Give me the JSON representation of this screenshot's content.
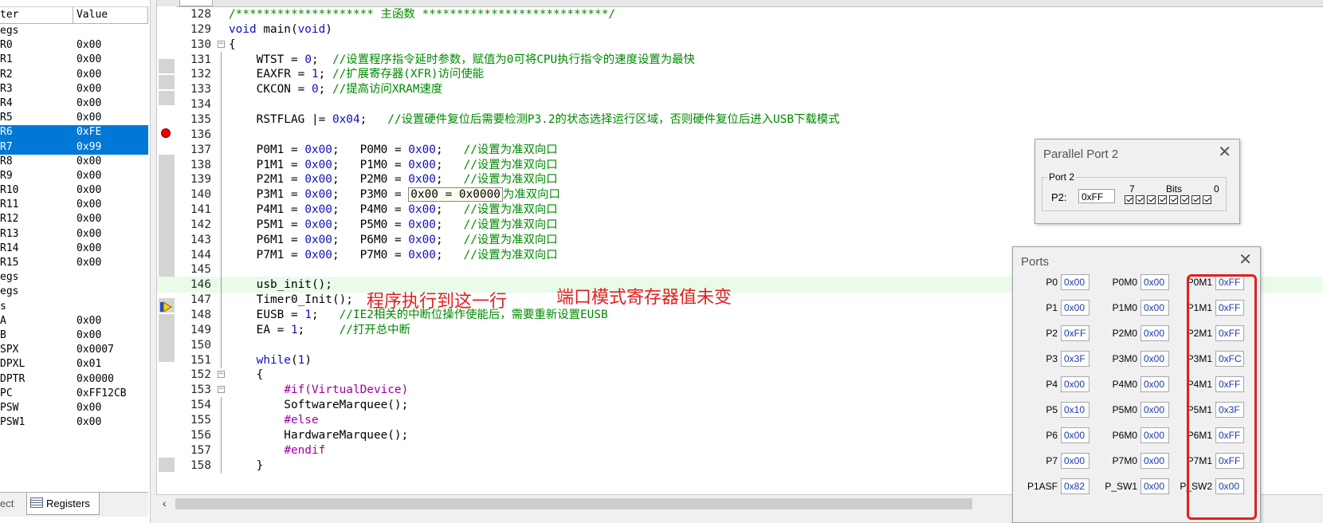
{
  "registers": {
    "header": {
      "name": "ter",
      "value": "Value"
    },
    "rows": [
      {
        "name": "egs",
        "value": "",
        "selected": false
      },
      {
        "name": "R0",
        "value": "0x00",
        "selected": false
      },
      {
        "name": "R1",
        "value": "0x00",
        "selected": false
      },
      {
        "name": "R2",
        "value": "0x00",
        "selected": false
      },
      {
        "name": "R3",
        "value": "0x00",
        "selected": false
      },
      {
        "name": "R4",
        "value": "0x00",
        "selected": false
      },
      {
        "name": "R5",
        "value": "0x00",
        "selected": false
      },
      {
        "name": "R6",
        "value": "0xFE",
        "selected": true
      },
      {
        "name": "R7",
        "value": "0x99",
        "selected": true
      },
      {
        "name": "R8",
        "value": "0x00",
        "selected": false
      },
      {
        "name": "R9",
        "value": "0x00",
        "selected": false
      },
      {
        "name": "R10",
        "value": "0x00",
        "selected": false
      },
      {
        "name": "R11",
        "value": "0x00",
        "selected": false
      },
      {
        "name": "R12",
        "value": "0x00",
        "selected": false
      },
      {
        "name": "R13",
        "value": "0x00",
        "selected": false
      },
      {
        "name": "R14",
        "value": "0x00",
        "selected": false
      },
      {
        "name": "R15",
        "value": "0x00",
        "selected": false
      },
      {
        "name": "egs",
        "value": "",
        "selected": false
      },
      {
        "name": "egs",
        "value": "",
        "selected": false
      },
      {
        "name": "s",
        "value": "",
        "selected": false
      },
      {
        "name": "A",
        "value": "0x00",
        "selected": false
      },
      {
        "name": "B",
        "value": "0x00",
        "selected": false
      },
      {
        "name": "SPX",
        "value": "0x0007",
        "selected": false
      },
      {
        "name": "DPXL",
        "value": "0x01",
        "selected": false
      },
      {
        "name": "DPTR",
        "value": "0x0000",
        "selected": false
      },
      {
        "name": "PC",
        "value": "0xFF12CB",
        "selected": false
      },
      {
        "name": "PSW",
        "value": "0x00",
        "selected": false
      },
      {
        "name": "PSW1",
        "value": "0x00",
        "selected": false
      }
    ],
    "tabs": {
      "project": "ect",
      "registers": "Registers"
    }
  },
  "editor": {
    "lines": [
      {
        "num": "128",
        "fold": "",
        "text": [
          [
            "cm",
            "/******************** 主函数 ***************************/"
          ]
        ]
      },
      {
        "num": "129",
        "fold": "",
        "text": [
          [
            "kw",
            "void"
          ],
          [
            "",
            " main("
          ],
          [
            "kw",
            "void"
          ],
          [
            "",
            ")"
          ]
        ]
      },
      {
        "num": "130",
        "fold": "box",
        "text": [
          [
            "",
            "{"
          ]
        ]
      },
      {
        "num": "131",
        "fold": "line",
        "text": [
          [
            "",
            "    WTST = "
          ],
          [
            "num",
            "0"
          ],
          [
            "",
            ";  "
          ],
          [
            "cm",
            "//设置程序指令延时参数，赋值为0可将CPU执行指令的速度设置为最快"
          ]
        ]
      },
      {
        "num": "132",
        "fold": "line",
        "text": [
          [
            "",
            "    EAXFR = "
          ],
          [
            "num",
            "1"
          ],
          [
            "",
            "; "
          ],
          [
            "cm",
            "//扩展寄存器(XFR)访问使能"
          ]
        ]
      },
      {
        "num": "133",
        "fold": "line",
        "text": [
          [
            "",
            "    CKCON = "
          ],
          [
            "num",
            "0"
          ],
          [
            "",
            "; "
          ],
          [
            "cm",
            "//提高访问XRAM速度"
          ]
        ]
      },
      {
        "num": "134",
        "fold": "line",
        "text": [
          [
            "",
            ""
          ]
        ]
      },
      {
        "num": "135",
        "fold": "line",
        "text": [
          [
            "",
            "    RSTFLAG |= "
          ],
          [
            "num",
            "0x04"
          ],
          [
            "",
            ";   "
          ],
          [
            "cm",
            "//设置硬件复位后需要检测P3.2的状态选择运行区域，否则硬件复位后进入USB下载模式"
          ]
        ]
      },
      {
        "num": "136",
        "fold": "line",
        "text": [
          [
            "",
            ""
          ]
        ]
      },
      {
        "num": "137",
        "fold": "line",
        "text": [
          [
            "",
            "    P0M1 = "
          ],
          [
            "num",
            "0x00"
          ],
          [
            "",
            ";   P0M0 = "
          ],
          [
            "num",
            "0x00"
          ],
          [
            "",
            ";   "
          ],
          [
            "cm",
            "//设置为准双向口"
          ]
        ]
      },
      {
        "num": "138",
        "fold": "line",
        "text": [
          [
            "",
            "    P1M1 = "
          ],
          [
            "num",
            "0x00"
          ],
          [
            "",
            ";   P1M0 = "
          ],
          [
            "num",
            "0x00"
          ],
          [
            "",
            ";   "
          ],
          [
            "cm",
            "//设置为准双向口"
          ]
        ]
      },
      {
        "num": "139",
        "fold": "line",
        "text": [
          [
            "",
            "    P2M1 = "
          ],
          [
            "num",
            "0x00"
          ],
          [
            "",
            ";   P2M0 = "
          ],
          [
            "num",
            "0x00"
          ],
          [
            "",
            ";   "
          ],
          [
            "cm",
            "//设置为准双向口"
          ]
        ]
      },
      {
        "num": "140",
        "fold": "line",
        "text": [
          [
            "",
            "    P3M1 = "
          ],
          [
            "num",
            "0x00"
          ],
          [
            "",
            ";   P3M0 = "
          ],
          [
            "tip",
            "0x00 = 0x0000"
          ],
          [
            "cm",
            "为准双向口"
          ]
        ]
      },
      {
        "num": "141",
        "fold": "line",
        "text": [
          [
            "",
            "    P4M1 = "
          ],
          [
            "num",
            "0x00"
          ],
          [
            "",
            ";   P4M0 = "
          ],
          [
            "num",
            "0x00"
          ],
          [
            "",
            ";   "
          ],
          [
            "cm",
            "//设置为准双向口"
          ]
        ]
      },
      {
        "num": "142",
        "fold": "line",
        "text": [
          [
            "",
            "    P5M1 = "
          ],
          [
            "num",
            "0x00"
          ],
          [
            "",
            ";   P5M0 = "
          ],
          [
            "num",
            "0x00"
          ],
          [
            "",
            ";   "
          ],
          [
            "cm",
            "//设置为准双向口"
          ]
        ]
      },
      {
        "num": "143",
        "fold": "line",
        "text": [
          [
            "",
            "    P6M1 = "
          ],
          [
            "num",
            "0x00"
          ],
          [
            "",
            ";   P6M0 = "
          ],
          [
            "num",
            "0x00"
          ],
          [
            "",
            ";   "
          ],
          [
            "cm",
            "//设置为准双向口"
          ]
        ]
      },
      {
        "num": "144",
        "fold": "line",
        "text": [
          [
            "",
            "    P7M1 = "
          ],
          [
            "num",
            "0x00"
          ],
          [
            "",
            ";   P7M0 = "
          ],
          [
            "num",
            "0x00"
          ],
          [
            "",
            ";   "
          ],
          [
            "cm",
            "//设置为准双向口"
          ]
        ]
      },
      {
        "num": "145",
        "fold": "line",
        "text": [
          [
            "",
            ""
          ]
        ]
      },
      {
        "num": "146",
        "fold": "line",
        "text": [
          [
            "",
            "    usb_init();"
          ]
        ]
      },
      {
        "num": "147",
        "fold": "line",
        "text": [
          [
            "",
            "    Timer0_Init();"
          ]
        ]
      },
      {
        "num": "148",
        "fold": "line",
        "text": [
          [
            "",
            "    EUSB = "
          ],
          [
            "num",
            "1"
          ],
          [
            "",
            ";   "
          ],
          [
            "cm",
            "//IE2相关的中断位操作使能后，需要重新设置EUSB"
          ]
        ]
      },
      {
        "num": "149",
        "fold": "line",
        "text": [
          [
            "",
            "    EA = "
          ],
          [
            "num",
            "1"
          ],
          [
            "",
            ";     "
          ],
          [
            "cm",
            "//打开总中断"
          ]
        ]
      },
      {
        "num": "150",
        "fold": "line",
        "text": [
          [
            "",
            ""
          ]
        ]
      },
      {
        "num": "151",
        "fold": "line",
        "text": [
          [
            "",
            "    "
          ],
          [
            "kw",
            "while"
          ],
          [
            "",
            "("
          ],
          [
            "num",
            "1"
          ],
          [
            "",
            ")"
          ]
        ]
      },
      {
        "num": "152",
        "fold": "box",
        "text": [
          [
            "",
            "    {"
          ]
        ]
      },
      {
        "num": "153",
        "fold": "box",
        "text": [
          [
            "",
            "        "
          ],
          [
            "pp2",
            "#if(VirtualDevice)"
          ]
        ]
      },
      {
        "num": "154",
        "fold": "line",
        "text": [
          [
            "",
            "        SoftwareMarquee();"
          ]
        ]
      },
      {
        "num": "155",
        "fold": "line",
        "text": [
          [
            "",
            "        "
          ],
          [
            "pp2",
            "#else"
          ]
        ]
      },
      {
        "num": "156",
        "fold": "line",
        "text": [
          [
            "",
            "        HardwareMarquee();"
          ]
        ]
      },
      {
        "num": "157",
        "fold": "line",
        "text": [
          [
            "",
            "        "
          ],
          [
            "pp2",
            "#endif"
          ]
        ]
      },
      {
        "num": "158",
        "fold": "line",
        "text": [
          [
            "",
            "    }"
          ]
        ]
      }
    ],
    "current_line": "146",
    "breakpoint_line": "135",
    "annotations": {
      "executed_here": "程序执行到这一行",
      "port_mode_unchanged": "端口模式寄存器值未变"
    }
  },
  "parallel_port2": {
    "title": "Parallel Port 2",
    "group": "Port 2",
    "label": "P2:",
    "value": "0xFF",
    "bit_high": "7",
    "bits": "Bits",
    "bit_low": "0",
    "bit_values": [
      1,
      1,
      1,
      1,
      1,
      1,
      1,
      1
    ]
  },
  "ports": {
    "title": "Ports",
    "rows": [
      {
        "p": "P0",
        "pv": "0x00",
        "m0": "P0M0",
        "m0v": "0x00",
        "m1": "P0M1",
        "m1v": "0xFF"
      },
      {
        "p": "P1",
        "pv": "0x00",
        "m0": "P1M0",
        "m0v": "0x00",
        "m1": "P1M1",
        "m1v": "0xFF"
      },
      {
        "p": "P2",
        "pv": "0xFF",
        "m0": "P2M0",
        "m0v": "0x00",
        "m1": "P2M1",
        "m1v": "0xFF"
      },
      {
        "p": "P3",
        "pv": "0x3F",
        "m0": "P3M0",
        "m0v": "0x00",
        "m1": "P3M1",
        "m1v": "0xFC"
      },
      {
        "p": "P4",
        "pv": "0x00",
        "m0": "P4M0",
        "m0v": "0x00",
        "m1": "P4M1",
        "m1v": "0xFF"
      },
      {
        "p": "P5",
        "pv": "0x10",
        "m0": "P5M0",
        "m0v": "0x00",
        "m1": "P5M1",
        "m1v": "0x3F"
      },
      {
        "p": "P6",
        "pv": "0x00",
        "m0": "P6M0",
        "m0v": "0x00",
        "m1": "P6M1",
        "m1v": "0xFF"
      },
      {
        "p": "P7",
        "pv": "0x00",
        "m0": "P7M0",
        "m0v": "0x00",
        "m1": "P7M1",
        "m1v": "0xFF"
      },
      {
        "p": "P1ASF",
        "pv": "0x82",
        "m0": "P_SW1",
        "m0v": "0x00",
        "m1": "P_SW2",
        "m1v": "0x00"
      }
    ]
  },
  "colors": {
    "selection": "#0078d7",
    "annotation_red": "#e02020",
    "comment_green": "#008a00",
    "keyword_blue": "#1010c0"
  }
}
